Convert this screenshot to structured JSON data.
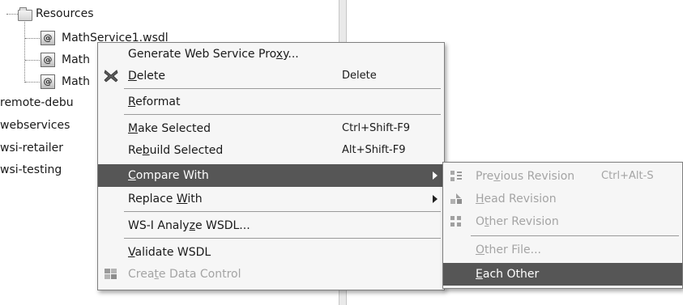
{
  "tree": {
    "folder_label": "Resources",
    "files": [
      "MathService1.wsdl",
      "Math",
      "Math"
    ],
    "projects": [
      "remote-debu",
      "webservices",
      "wsi-retailer",
      "wsi-testing"
    ]
  },
  "context_menu": {
    "items": [
      {
        "pre": "Generate Web Service Pro",
        "mn": "x",
        "post": "y...",
        "accel": ""
      },
      {
        "pre": "",
        "mn": "D",
        "post": "elete",
        "accel": "Delete"
      },
      {
        "pre": "",
        "mn": "R",
        "post": "eformat",
        "accel": ""
      },
      {
        "pre": "",
        "mn": "M",
        "post": "ake Selected",
        "accel": "Ctrl+Shift-F9"
      },
      {
        "pre": "Re",
        "mn": "b",
        "post": "uild Selected",
        "accel": "Alt+Shift-F9"
      },
      {
        "pre": "",
        "mn": "C",
        "post": "ompare With",
        "accel": ""
      },
      {
        "pre": "Replace ",
        "mn": "W",
        "post": "ith",
        "accel": ""
      },
      {
        "pre": "WS-I Analy",
        "mn": "z",
        "post": "e WSDL...",
        "accel": ""
      },
      {
        "pre": "",
        "mn": "V",
        "post": "alidate WSDL",
        "accel": ""
      },
      {
        "pre": "Crea",
        "mn": "t",
        "post": "e Data Control",
        "accel": ""
      }
    ]
  },
  "compare_submenu": {
    "items": [
      {
        "pre": "Pre",
        "mn": "v",
        "post": "ious Revision",
        "accel": "Ctrl+Alt-S"
      },
      {
        "pre": "",
        "mn": "H",
        "post": "ead Revision",
        "accel": ""
      },
      {
        "pre": "O",
        "mn": "t",
        "post": "her Revision",
        "accel": ""
      },
      {
        "pre": "",
        "mn": "O",
        "post": "ther File...",
        "accel": ""
      },
      {
        "pre": "",
        "mn": "E",
        "post": "ach Other",
        "accel": ""
      }
    ]
  },
  "colors": {
    "menu_bg": "#f6f6f6",
    "highlight": "#565656",
    "disabled_text": "#a4a4a4"
  },
  "icons": {
    "delete": "red-x-icon",
    "data_control": "data-control-icon",
    "previous_revision": "previous-revision-icon",
    "head_revision": "head-revision-icon",
    "other_revision": "other-revision-icon"
  }
}
